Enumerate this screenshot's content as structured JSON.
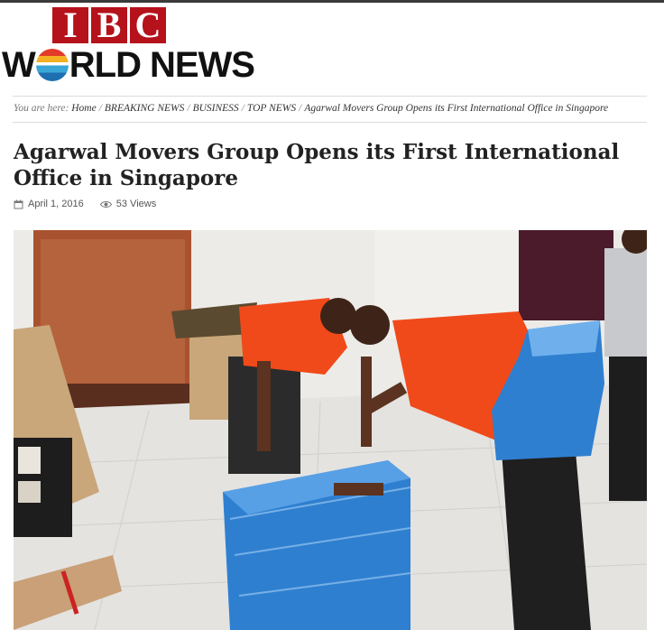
{
  "site": {
    "logo_top": [
      "I",
      "B",
      "C"
    ],
    "logo_w": "W",
    "logo_rld": "RLD",
    "logo_news": "NEWS"
  },
  "breadcrumb": {
    "prefix": "You are here:",
    "items": [
      "Home",
      "BREAKING NEWS",
      "BUSINESS",
      "TOP NEWS",
      "Agarwal Movers Group Opens its First International Office in Singapore"
    ]
  },
  "article": {
    "title": "Agarwal Movers Group Opens its First International Office in Singapore",
    "date": "April 1, 2016",
    "views": "53 Views"
  },
  "colors": {
    "brand_red": "#b5121b",
    "shirt_orange": "#f04a1a",
    "package_blue": "#2f7fd0"
  }
}
